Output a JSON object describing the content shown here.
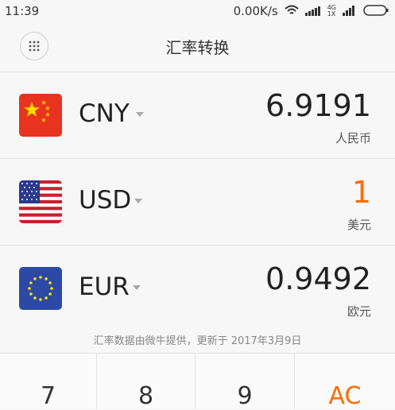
{
  "status": {
    "time": "11:39",
    "speed": "0.00K/s",
    "net1": "4G",
    "net2": "1X"
  },
  "header": {
    "title": "汇率转换"
  },
  "currencies": [
    {
      "code": "CNY",
      "value": "6.9191",
      "name": "人民币"
    },
    {
      "code": "USD",
      "value": "1",
      "name": "美元"
    },
    {
      "code": "EUR",
      "value": "0.9492",
      "name": "欧元"
    }
  ],
  "note": "汇率数据由微牛提供，更新于 2017年3月9日",
  "keypad": [
    "7",
    "8",
    "9",
    "AC"
  ],
  "colors": {
    "accent": "#ff6a00",
    "background": "#f7f7f7",
    "divider": "#e3e3e3"
  }
}
